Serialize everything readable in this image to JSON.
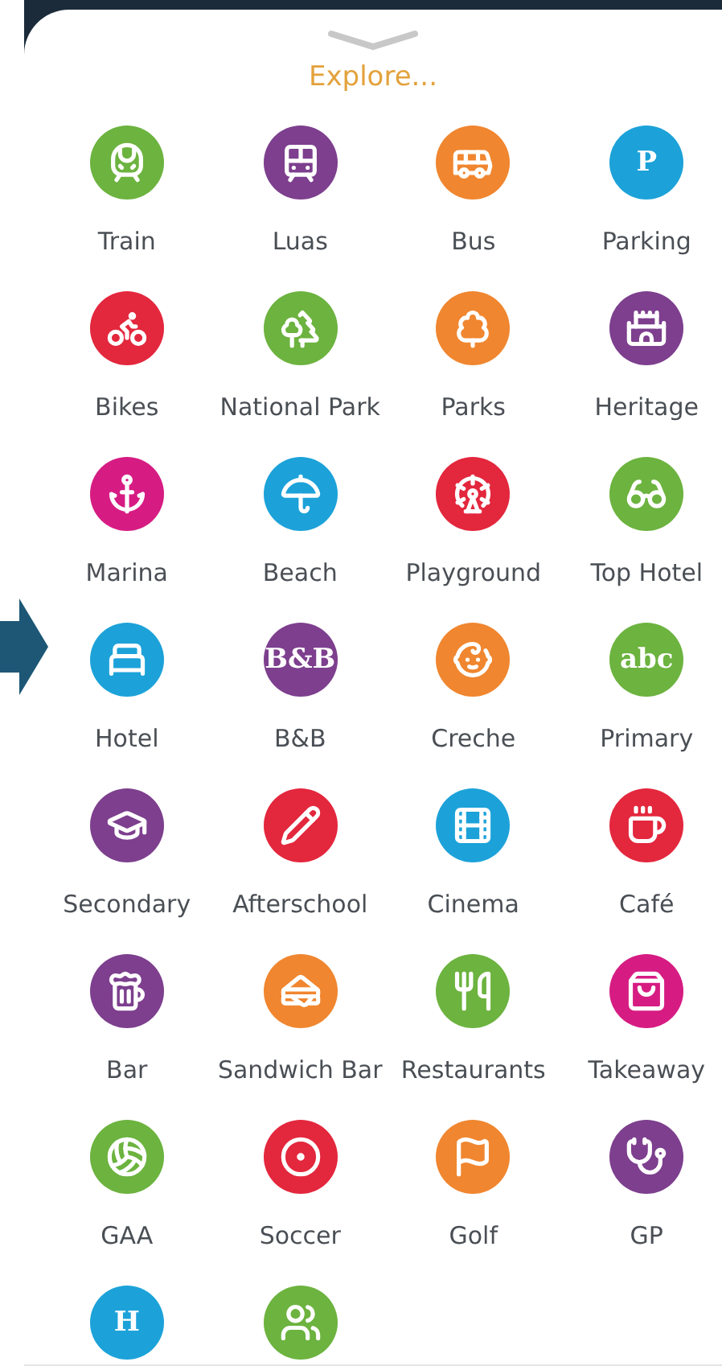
{
  "title": "Explore...",
  "items": [
    {
      "label": "Train",
      "kind": "icon",
      "color": "#6cb33f"
    },
    {
      "label": "Luas",
      "kind": "icon",
      "color": "#7d3f8e"
    },
    {
      "label": "Bus",
      "kind": "icon",
      "color": "#f0862f"
    },
    {
      "label": "Parking",
      "kind": "glyph",
      "glyph": "P",
      "color": "#1ca2d9"
    },
    {
      "label": "Bikes",
      "kind": "icon",
      "color": "#e3273d"
    },
    {
      "label": "National Park",
      "kind": "icon",
      "color": "#6cb33f"
    },
    {
      "label": "Parks",
      "kind": "icon",
      "color": "#f0862f"
    },
    {
      "label": "Heritage",
      "kind": "icon",
      "color": "#7d3f8e"
    },
    {
      "label": "Marina",
      "kind": "icon",
      "color": "#d61c83"
    },
    {
      "label": "Beach",
      "kind": "icon",
      "color": "#1ca2d9"
    },
    {
      "label": "Playground",
      "kind": "icon",
      "color": "#e3273d"
    },
    {
      "label": "Top Hotel",
      "kind": "icon",
      "color": "#6cb33f"
    },
    {
      "label": "Hotel",
      "kind": "icon",
      "color": "#1ca2d9"
    },
    {
      "label": "B&B",
      "kind": "glyph",
      "glyph": "B&B",
      "color": "#7d3f8e"
    },
    {
      "label": "Creche",
      "kind": "icon",
      "color": "#f0862f"
    },
    {
      "label": "Primary",
      "kind": "glyph",
      "glyph": "abc",
      "color": "#6cb33f"
    },
    {
      "label": "Secondary",
      "kind": "icon",
      "color": "#7d3f8e"
    },
    {
      "label": "Afterschool",
      "kind": "icon",
      "color": "#e3273d"
    },
    {
      "label": "Cinema",
      "kind": "icon",
      "color": "#1ca2d9"
    },
    {
      "label": "Café",
      "kind": "icon",
      "color": "#e3273d"
    },
    {
      "label": "Bar",
      "kind": "icon",
      "color": "#7d3f8e"
    },
    {
      "label": "Sandwich Bar",
      "kind": "icon",
      "color": "#f0862f"
    },
    {
      "label": "Restaurants",
      "kind": "icon",
      "color": "#6cb33f"
    },
    {
      "label": "Takeaway",
      "kind": "icon",
      "color": "#d61c83"
    },
    {
      "label": "GAA",
      "kind": "icon",
      "color": "#6cb33f"
    },
    {
      "label": "Soccer",
      "kind": "icon",
      "color": "#e3273d"
    },
    {
      "label": "Golf",
      "kind": "icon",
      "color": "#f0862f"
    },
    {
      "label": "GP",
      "kind": "icon",
      "color": "#7d3f8e"
    },
    {
      "kind": "glyph",
      "glyph": "H",
      "color": "#1ca2d9"
    },
    {
      "kind": "icon",
      "color": "#6cb33f"
    }
  ]
}
